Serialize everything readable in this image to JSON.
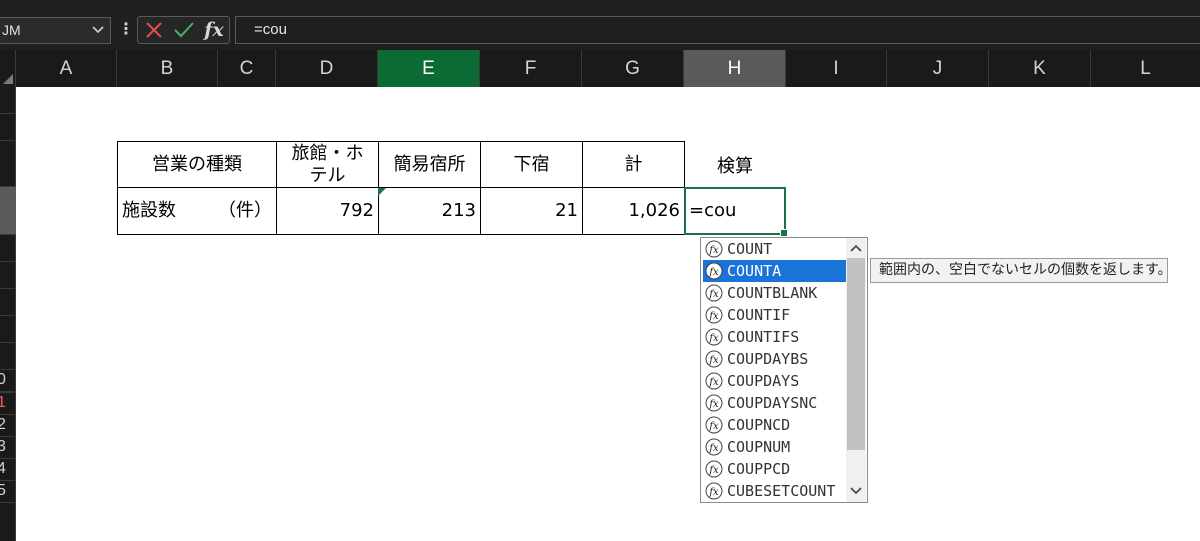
{
  "formula_bar": {
    "name_box": "JM",
    "cancel_icon": "x-icon",
    "enter_icon": "check-icon",
    "fx_label": "fx",
    "formula": "=cou"
  },
  "columns": [
    "A",
    "B",
    "C",
    "D",
    "E",
    "F",
    "G",
    "H",
    "I",
    "J",
    "K",
    "L"
  ],
  "selected_column": "E",
  "active_column": "H",
  "rows": [
    "",
    "",
    "",
    "",
    "",
    "",
    "",
    "",
    "",
    "",
    "0",
    "1",
    "2",
    "3",
    "4",
    "5"
  ],
  "table": {
    "headers": {
      "type": "営業の種類",
      "ryokan_line1": "旅館・ホ",
      "ryokan_line2": "テル",
      "kan_i": "簡易宿所",
      "geshuku": "下宿",
      "total": "計",
      "check": "検算"
    },
    "row": {
      "label_main": "施設数",
      "label_unit": "（件）",
      "ryokan": "792",
      "kan_i": "213",
      "geshuku": "21",
      "total": "1,026",
      "edit_value": "=cou"
    }
  },
  "autocomplete": {
    "items": [
      "COUNT",
      "COUNTA",
      "COUNTBLANK",
      "COUNTIF",
      "COUNTIFS",
      "COUPDAYBS",
      "COUPDAYS",
      "COUPDAYSNC",
      "COUPNCD",
      "COUPNUM",
      "COUPPCD",
      "CUBESETCOUNT"
    ],
    "highlighted_index": 1,
    "tooltip": "範囲内の、空白でないセルの個数を返します。"
  },
  "colors": {
    "accent_green": "#1e7145",
    "selection_blue": "#1a73d9",
    "header_bg": "#1a1a1a"
  }
}
